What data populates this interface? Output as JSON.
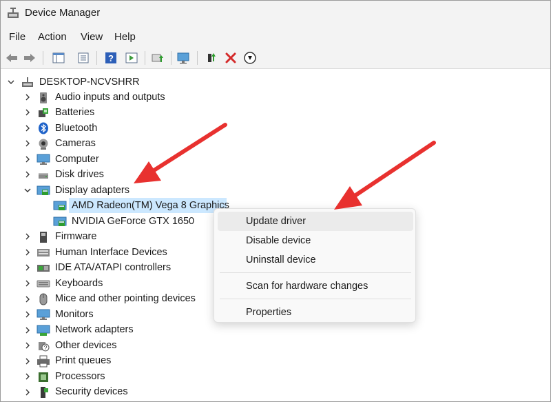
{
  "window": {
    "title": "Device Manager"
  },
  "menu": {
    "items": [
      "File",
      "Action",
      "View",
      "Help"
    ]
  },
  "toolbar": {
    "buttons": [
      "back-arrow-icon",
      "forward-arrow-icon",
      "console-tree-icon",
      "properties-icon",
      "help-icon",
      "action-pane-icon",
      "update-driver-icon",
      "monitor-scan-icon",
      "add-driver-icon",
      "uninstall-x-icon",
      "disable-down-icon"
    ]
  },
  "tree": {
    "root": "DESKTOP-NCVSHRR",
    "categories": [
      "Audio inputs and outputs",
      "Batteries",
      "Bluetooth",
      "Cameras",
      "Computer",
      "Disk drives",
      "Display adapters",
      "Firmware",
      "Human Interface Devices",
      "IDE ATA/ATAPI controllers",
      "Keyboards",
      "Mice and other pointing devices",
      "Monitors",
      "Network adapters",
      "Other devices",
      "Print queues",
      "Processors",
      "Security devices"
    ],
    "display_children": [
      "AMD Radeon(TM) Vega 8 Graphics",
      "NVIDIA GeForce GTX 1650"
    ]
  },
  "context_menu": {
    "update": "Update driver",
    "disable": "Disable device",
    "uninstall": "Uninstall device",
    "scan": "Scan for hardware changes",
    "properties": "Properties"
  },
  "colors": {
    "selection": "#cce8ff",
    "arrow": "#e8312f",
    "chrome": "#f3f3f3"
  }
}
